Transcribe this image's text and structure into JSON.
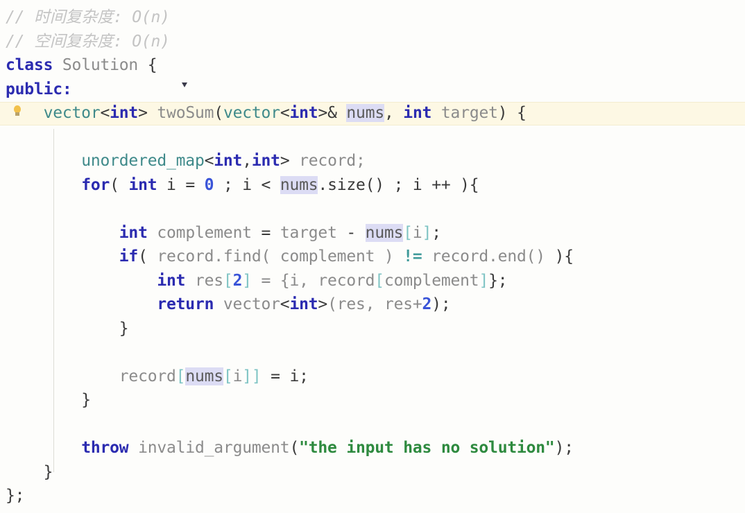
{
  "editor": {
    "language": "cpp",
    "background_color": "#fdfdfb",
    "current_line_highlight_color": "#fdf8e4",
    "occurrence_highlight_color": "#dcdcf4",
    "gutter_icon": "lightbulb-icon",
    "indent_guide_color": "#dcdcd6"
  },
  "colors": {
    "comment": "#c4c4c4",
    "keyword": "#2b2bb0",
    "type": "#3f8a8a",
    "number": "#3a54d8",
    "string": "#2e8a3f",
    "operator": "#3f9a9a",
    "identifier": "#5a5a5a",
    "bracket": "#7fc4c4"
  },
  "code": {
    "lines": [
      {
        "n": 1,
        "text": "// 时间复杂度: O(n)",
        "tokens": [
          {
            "t": "// 时间复杂度: O(n)",
            "c": "tok-comment"
          }
        ]
      },
      {
        "n": 2,
        "text": "// 空间复杂度: O(n)",
        "tokens": [
          {
            "t": "// 空间复杂度: O(n)",
            "c": "tok-comment"
          }
        ]
      },
      {
        "n": 3,
        "text": "class Solution {",
        "tokens": [
          {
            "t": "class",
            "c": "tok-keyword"
          },
          {
            "t": " ",
            "c": "tok-plain"
          },
          {
            "t": "Solution",
            "c": "tok-plain"
          },
          {
            "t": " ",
            "c": "tok-plain"
          },
          {
            "t": "{",
            "c": "tok-dark"
          }
        ]
      },
      {
        "n": 4,
        "text": "public:",
        "tokens": [
          {
            "t": "public:",
            "c": "tok-keyword"
          }
        ]
      },
      {
        "n": 5,
        "text": "    vector<int> twoSum(vector<int>& nums, int target) {",
        "highlighted": true,
        "tokens": [
          {
            "t": "    ",
            "c": "tok-plain"
          },
          {
            "t": "vector",
            "c": "tok-type"
          },
          {
            "t": "<",
            "c": "tok-dark"
          },
          {
            "t": "int",
            "c": "tok-keyword"
          },
          {
            "t": ">",
            "c": "tok-dark"
          },
          {
            "t": " ",
            "c": "tok-plain"
          },
          {
            "t": "twoSum",
            "c": "tok-plain"
          },
          {
            "t": "(",
            "c": "tok-dark"
          },
          {
            "t": "vector",
            "c": "tok-type"
          },
          {
            "t": "<",
            "c": "tok-dark"
          },
          {
            "t": "int",
            "c": "tok-keyword"
          },
          {
            "t": ">&",
            "c": "tok-dark"
          },
          {
            "t": " ",
            "c": "tok-plain"
          },
          {
            "t": "nums",
            "c": "tok-ident hl-occurrence"
          },
          {
            "t": ", ",
            "c": "tok-dark"
          },
          {
            "t": "int",
            "c": "tok-keyword"
          },
          {
            "t": " ",
            "c": "tok-plain"
          },
          {
            "t": "target",
            "c": "tok-plain"
          },
          {
            "t": ") {",
            "c": "tok-dark"
          }
        ]
      },
      {
        "n": 6,
        "text": "",
        "tokens": []
      },
      {
        "n": 7,
        "text": "        unordered_map<int,int> record;",
        "tokens": [
          {
            "t": "        ",
            "c": "tok-plain"
          },
          {
            "t": "unordered_map",
            "c": "tok-type"
          },
          {
            "t": "<",
            "c": "tok-dark"
          },
          {
            "t": "int",
            "c": "tok-keyword"
          },
          {
            "t": ",",
            "c": "tok-dark"
          },
          {
            "t": "int",
            "c": "tok-keyword"
          },
          {
            "t": ">",
            "c": "tok-dark"
          },
          {
            "t": " ",
            "c": "tok-plain"
          },
          {
            "t": "record;",
            "c": "tok-plain"
          }
        ]
      },
      {
        "n": 8,
        "text": "        for( int i = 0 ; i < nums.size() ; i ++ ){",
        "tokens": [
          {
            "t": "        ",
            "c": "tok-plain"
          },
          {
            "t": "for",
            "c": "tok-keyword"
          },
          {
            "t": "( ",
            "c": "tok-dark"
          },
          {
            "t": "int",
            "c": "tok-keyword"
          },
          {
            "t": " i = ",
            "c": "tok-dark"
          },
          {
            "t": "0",
            "c": "tok-number"
          },
          {
            "t": " ; i < ",
            "c": "tok-dark"
          },
          {
            "t": "nums",
            "c": "tok-ident hl-occurrence"
          },
          {
            "t": ".size() ; i ++ ){",
            "c": "tok-dark"
          }
        ]
      },
      {
        "n": 9,
        "text": "",
        "tokens": []
      },
      {
        "n": 10,
        "text": "            int complement = target - nums[i];",
        "tokens": [
          {
            "t": "            ",
            "c": "tok-plain"
          },
          {
            "t": "int",
            "c": "tok-keyword"
          },
          {
            "t": " ",
            "c": "tok-plain"
          },
          {
            "t": "complement",
            "c": "tok-plain"
          },
          {
            "t": " = ",
            "c": "tok-dark"
          },
          {
            "t": "target",
            "c": "tok-plain"
          },
          {
            "t": " - ",
            "c": "tok-dark"
          },
          {
            "t": "nums",
            "c": "tok-ident hl-occurrence"
          },
          {
            "t": "[",
            "c": "tok-bracket"
          },
          {
            "t": "i",
            "c": "tok-plain"
          },
          {
            "t": "]",
            "c": "tok-bracket"
          },
          {
            "t": ";",
            "c": "tok-dark"
          }
        ]
      },
      {
        "n": 11,
        "text": "            if( record.find( complement ) != record.end() ){",
        "tokens": [
          {
            "t": "            ",
            "c": "tok-plain"
          },
          {
            "t": "if",
            "c": "tok-keyword"
          },
          {
            "t": "( ",
            "c": "tok-dark"
          },
          {
            "t": "record.find( complement ) ",
            "c": "tok-plain"
          },
          {
            "t": "!=",
            "c": "tok-op"
          },
          {
            "t": " ",
            "c": "tok-plain"
          },
          {
            "t": "record.end() ",
            "c": "tok-plain"
          },
          {
            "t": "){",
            "c": "tok-dark"
          }
        ]
      },
      {
        "n": 12,
        "text": "                int res[2] = {i, record[complement]};",
        "tokens": [
          {
            "t": "                ",
            "c": "tok-plain"
          },
          {
            "t": "int",
            "c": "tok-keyword"
          },
          {
            "t": " res",
            "c": "tok-plain"
          },
          {
            "t": "[",
            "c": "tok-bracket"
          },
          {
            "t": "2",
            "c": "tok-number"
          },
          {
            "t": "]",
            "c": "tok-bracket"
          },
          {
            "t": " = {i, record",
            "c": "tok-plain"
          },
          {
            "t": "[",
            "c": "tok-bracket"
          },
          {
            "t": "complement",
            "c": "tok-plain"
          },
          {
            "t": "]",
            "c": "tok-bracket"
          },
          {
            "t": "};",
            "c": "tok-dark"
          }
        ]
      },
      {
        "n": 13,
        "text": "                return vector<int>(res, res+2);",
        "tokens": [
          {
            "t": "                ",
            "c": "tok-plain"
          },
          {
            "t": "return",
            "c": "tok-keyword"
          },
          {
            "t": " ",
            "c": "tok-plain"
          },
          {
            "t": "vector",
            "c": "tok-plain"
          },
          {
            "t": "<",
            "c": "tok-dark"
          },
          {
            "t": "int",
            "c": "tok-keyword"
          },
          {
            "t": ">",
            "c": "tok-dark"
          },
          {
            "t": "(res, res+",
            "c": "tok-plain"
          },
          {
            "t": "2",
            "c": "tok-number"
          },
          {
            "t": ");",
            "c": "tok-dark"
          }
        ]
      },
      {
        "n": 14,
        "text": "            }",
        "tokens": [
          {
            "t": "            ",
            "c": "tok-plain"
          },
          {
            "t": "}",
            "c": "tok-dark"
          }
        ]
      },
      {
        "n": 15,
        "text": "",
        "tokens": []
      },
      {
        "n": 16,
        "text": "            record[nums[i]] = i;",
        "tokens": [
          {
            "t": "            ",
            "c": "tok-plain"
          },
          {
            "t": "record",
            "c": "tok-plain"
          },
          {
            "t": "[",
            "c": "tok-bracket"
          },
          {
            "t": "nums",
            "c": "tok-ident hl-occurrence"
          },
          {
            "t": "[",
            "c": "tok-bracket"
          },
          {
            "t": "i",
            "c": "tok-plain"
          },
          {
            "t": "]]",
            "c": "tok-bracket"
          },
          {
            "t": " = i;",
            "c": "tok-dark"
          }
        ]
      },
      {
        "n": 17,
        "text": "        }",
        "tokens": [
          {
            "t": "        ",
            "c": "tok-plain"
          },
          {
            "t": "}",
            "c": "tok-dark"
          }
        ]
      },
      {
        "n": 18,
        "text": "",
        "tokens": []
      },
      {
        "n": 19,
        "text": "        throw invalid_argument(\"the input has no solution\");",
        "tokens": [
          {
            "t": "        ",
            "c": "tok-plain"
          },
          {
            "t": "throw",
            "c": "tok-keyword"
          },
          {
            "t": " ",
            "c": "tok-plain"
          },
          {
            "t": "invalid_argument",
            "c": "tok-plain"
          },
          {
            "t": "(",
            "c": "tok-dark"
          },
          {
            "t": "\"the input has no solution\"",
            "c": "tok-string"
          },
          {
            "t": ");",
            "c": "tok-dark"
          }
        ]
      },
      {
        "n": 20,
        "text": "    }",
        "tokens": [
          {
            "t": "    ",
            "c": "tok-plain"
          },
          {
            "t": "}",
            "c": "tok-dark"
          }
        ]
      },
      {
        "n": 21,
        "text": "};",
        "tokens": [
          {
            "t": "};",
            "c": "tok-dark"
          }
        ]
      }
    ]
  }
}
